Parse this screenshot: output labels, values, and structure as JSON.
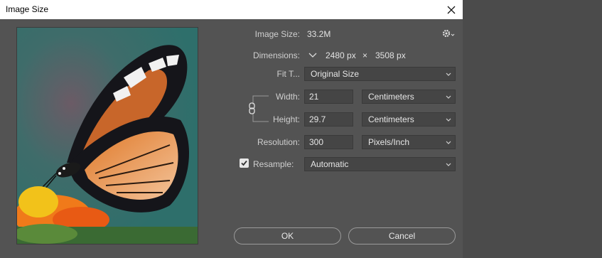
{
  "window": {
    "title": "Image Size"
  },
  "info": {
    "image_size_label": "Image Size:",
    "image_size_value": "33.2M",
    "dimensions_label": "Dimensions:",
    "dim_width": "2480 px",
    "dim_times": "×",
    "dim_height": "3508 px"
  },
  "fit_to": {
    "label": "Fit T...",
    "value": "Original Size"
  },
  "width": {
    "label": "Width:",
    "value": "21",
    "unit": "Centimeters"
  },
  "height": {
    "label": "Height:",
    "value": "29.7",
    "unit": "Centimeters"
  },
  "resolution": {
    "label": "Resolution:",
    "value": "300",
    "unit": "Pixels/Inch"
  },
  "resample": {
    "label": "Resample:",
    "checked": true,
    "value": "Automatic"
  },
  "buttons": {
    "ok": "OK",
    "cancel": "Cancel"
  },
  "icons": {
    "close": "close-icon",
    "gear": "gear-icon",
    "chevron": "chevron-down-icon",
    "link": "link-icon",
    "check": "check-icon"
  },
  "colors": {
    "bg": "#535353",
    "titlebar": "#ffffff",
    "field": "#454545"
  }
}
